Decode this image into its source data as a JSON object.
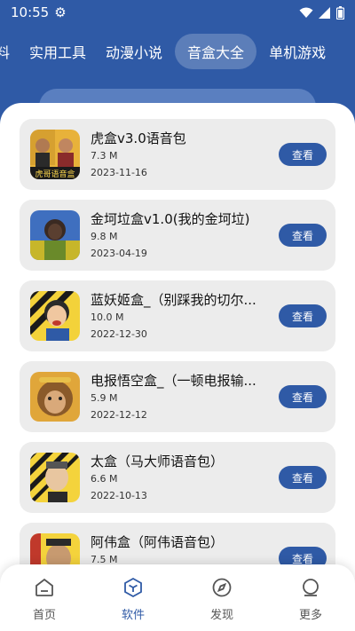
{
  "status_bar": {
    "time": "10:55",
    "icons": [
      "settings-gear-icon",
      "wifi-icon",
      "signal-icon",
      "battery-icon"
    ]
  },
  "category_tabs": [
    {
      "label": "料",
      "active": false
    },
    {
      "label": "实用工具",
      "active": false
    },
    {
      "label": "动漫小说",
      "active": false
    },
    {
      "label": "音盒大全",
      "active": true
    },
    {
      "label": "单机游戏",
      "active": false
    }
  ],
  "items": [
    {
      "title": "虎盒v3.0语音包",
      "size": "7.3 M",
      "date": "2023-11-16",
      "button": "查看",
      "thumb_caption": "虎哥语音盒"
    },
    {
      "title": "金坷垃盒v1.0(我的金坷垃)",
      "size": "9.8 M",
      "date": "2023-04-19",
      "button": "查看"
    },
    {
      "title": "蓝妖姬盒_（别踩我的切尔...",
      "size": "10.0 M",
      "date": "2022-12-30",
      "button": "查看"
    },
    {
      "title": "电报悟空盒_（一顿电报输...",
      "size": "5.9 M",
      "date": "2022-12-12",
      "button": "查看"
    },
    {
      "title": "太盒（马大师语音包）",
      "size": "6.6 M",
      "date": "2022-10-13",
      "button": "查看"
    },
    {
      "title": "阿伟盒（阿伟语音包）",
      "size": "7.5 M",
      "date": "",
      "button": "查看"
    }
  ],
  "bottom_nav": [
    {
      "label": "首页",
      "icon": "home-icon",
      "active": false
    },
    {
      "label": "软件",
      "icon": "cube-icon",
      "active": true
    },
    {
      "label": "发现",
      "icon": "compass-icon",
      "active": false
    },
    {
      "label": "更多",
      "icon": "profile-icon",
      "active": false
    }
  ],
  "colors": {
    "primary": "#2f5aa6",
    "card_bg": "#ececec",
    "sheet_bg": "#ffffff"
  }
}
